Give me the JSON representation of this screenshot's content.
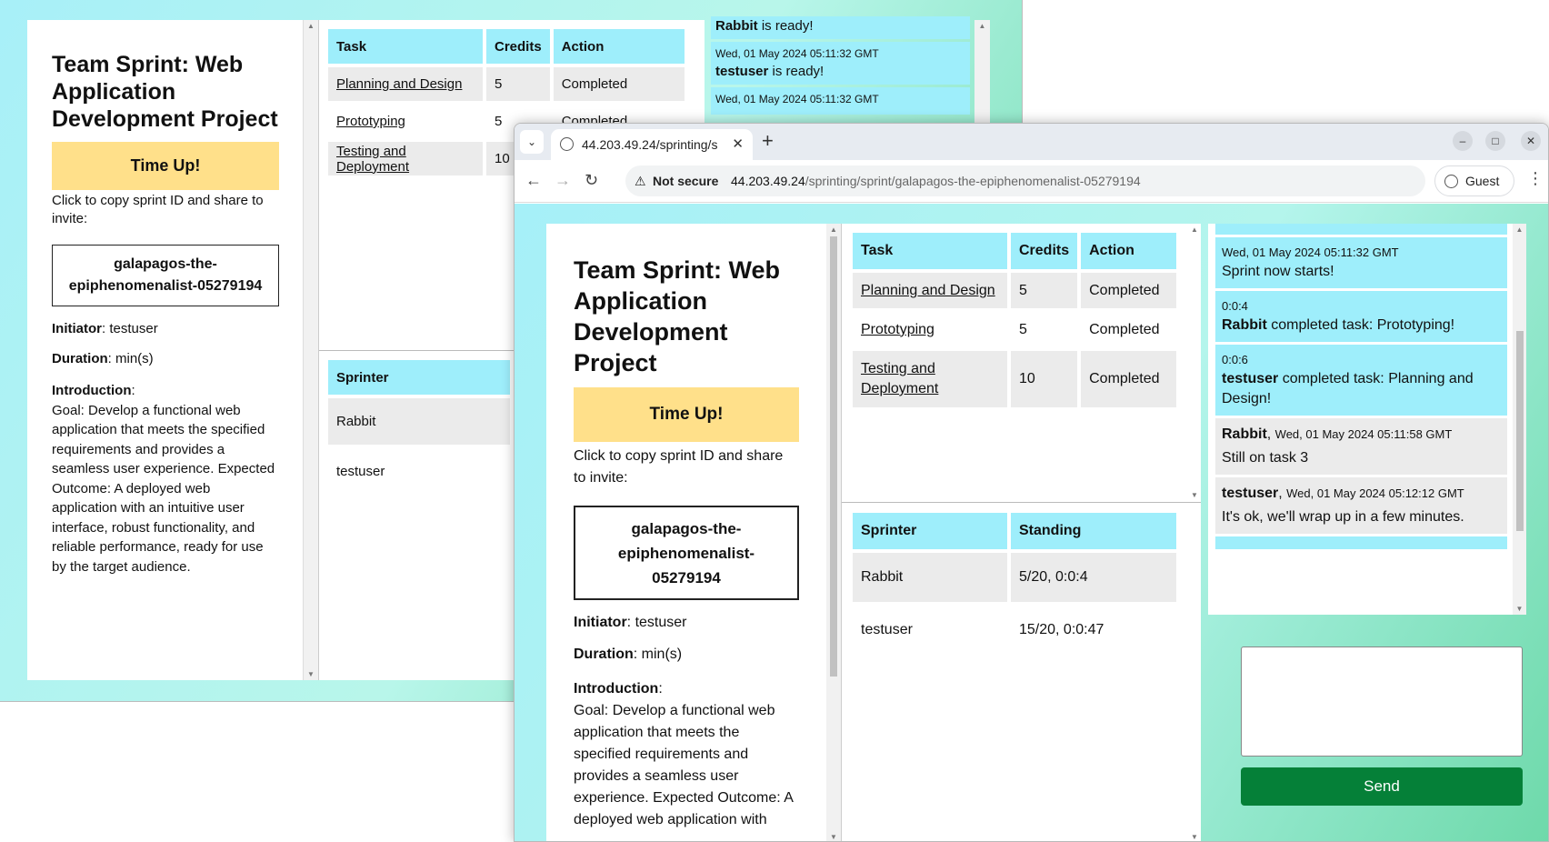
{
  "project": {
    "title": "Team Sprint: Web Application Development Project",
    "time_status": "Time Up!",
    "invite_text": "Click to copy sprint ID and share to invite:",
    "sprint_id": "galapagos-the-epiphenomenalist-05279194",
    "initiator_label": "Initiator",
    "initiator": "testuser",
    "duration_label": "Duration",
    "duration": "min(s)",
    "intro_label": "Introduction",
    "intro_text": "Goal: Develop a functional web application that meets the specified requirements and provides a seamless user experience. Expected Outcome: A deployed web application with an intuitive user interface, robust functionality, and reliable performance, ready for use by the target audience.",
    "intro_text_front": "Goal: Develop a functional web application that meets the specified requirements and provides a seamless user experience. Expected Outcome: A deployed web application with"
  },
  "tasks": {
    "headers": [
      "Task",
      "Credits",
      "Action"
    ],
    "rows": [
      {
        "task": "Planning and Design",
        "credits": "5",
        "action": "Completed"
      },
      {
        "task": "Prototyping",
        "credits": "5",
        "action": "Completed"
      },
      {
        "task": "Testing and Deployment",
        "credits": "10",
        "action": "Completed"
      }
    ]
  },
  "sprinters": {
    "headers": [
      "Sprinter",
      "Standing"
    ],
    "rows": [
      {
        "name": "Rabbit",
        "standing": "5/20, 0:0:4"
      },
      {
        "name": "testuser",
        "standing": "15/20, 0:0:47"
      }
    ]
  },
  "bg_chat": [
    {
      "ts": "",
      "user": "Rabbit",
      "text": " is ready!"
    },
    {
      "ts": "Wed, 01 May 2024 05:11:32 GMT",
      "user": "testuser",
      "text": " is ready!"
    },
    {
      "ts": "Wed, 01 May 2024 05:11:32 GMT",
      "user": "",
      "text": ""
    }
  ],
  "chat": {
    "m1_ts": "Wed, 01 May 2024 05:11:32 GMT",
    "m1_text": "Sprint now starts!",
    "m2_ts": "0:0:4",
    "m2_user": "Rabbit",
    "m2_text": " completed task: Prototyping!",
    "m3_ts": "0:0:6",
    "m3_user": "testuser",
    "m3_text": " completed task: Planning and Design!",
    "m4_user": "Rabbit",
    "m4_ts": "Wed, 01 May 2024 05:11:58 GMT",
    "m4_text": "Still on task 3",
    "m5_user": "testuser",
    "m5_ts": "Wed, 01 May 2024 05:12:12 GMT",
    "m5_text": "It's ok, we'll wrap up in a few minutes.",
    "send_label": "Send",
    "input_value": ""
  },
  "browser": {
    "tab_title": "44.203.49.24/sprinting/s",
    "security_label": "Not secure",
    "url_host": "44.203.49.24",
    "url_path": "/sprinting/sprint/galapagos-the-epiphenomenalist-05279194",
    "profile_label": "Guest"
  }
}
